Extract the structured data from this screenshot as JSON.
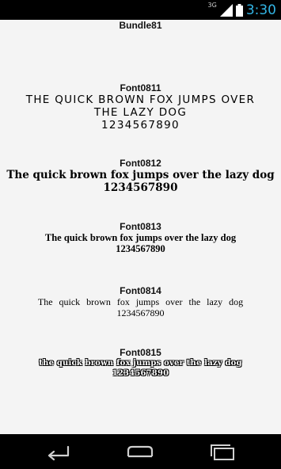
{
  "status_bar": {
    "network": "3G",
    "time": "3:30"
  },
  "bundle_title": "Bundle81",
  "fonts": [
    {
      "name": "Font0811",
      "lines": [
        "THE QUICK BROWN FOX JUMPS OVER",
        "THE LAZY DOG",
        "1234567890"
      ]
    },
    {
      "name": "Font0812",
      "lines": [
        "The quick brown fox jumps over the lazy dog",
        "1234567890"
      ]
    },
    {
      "name": "Font0813",
      "lines": [
        "The quick brown fox jumps over the lazy dog",
        "1234567890"
      ]
    },
    {
      "name": "Font0814",
      "lines": [
        "The quick brown fox jumps over the lazy dog",
        "1234567890"
      ]
    },
    {
      "name": "Font0815",
      "lines": [
        "the quick brown fox jumps over the lazy dog",
        "1234567890"
      ]
    }
  ],
  "nav_bar": {
    "icons": [
      "back-icon",
      "home-icon",
      "recents-icon"
    ]
  },
  "colors": {
    "clock": "#33b5e5",
    "background": "#f4f4f4",
    "bars": "#000000"
  }
}
